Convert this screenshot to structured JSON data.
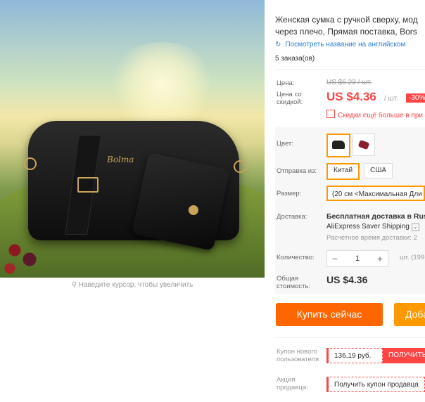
{
  "product": {
    "title_line1": "Женская сумка с ручкой сверху, мод",
    "title_line2": "через плечо, Прямая поставка, Bors",
    "translate_link": "Посмотреть название на английском",
    "orders": "5 заказа(ов)",
    "bag_logo": "Bolma"
  },
  "gallery": {
    "zoom_hint": "Наведите курсор, чтобы увеличить"
  },
  "price": {
    "label": "Цена:",
    "old": "US $6.23 / шт.",
    "discount_label": "Цена со скидкой:",
    "current": "US $4.36",
    "unit": "/ шт.",
    "discount": "-30%",
    "promo": "Скидки ещё больше в при"
  },
  "options": {
    "color_label": "Цвет:",
    "ship_from_label": "Отправка из:",
    "ship_from": [
      "Китай",
      "США"
    ],
    "ship_from_selected": 0,
    "size_label": "Размер:",
    "size_value": "(20 см <Максимальная Дли"
  },
  "delivery": {
    "label": "Доставка:",
    "main": "Бесплатная доставка в Russ",
    "service": "AliExpress Saver Shipping",
    "time": "Расчетное время доставки: 2"
  },
  "quantity": {
    "label": "Количество:",
    "minus": "−",
    "value": "1",
    "plus": "+",
    "note": "шт. (199 ш"
  },
  "total": {
    "label": "Общая стоимость:",
    "value": "US $4.36"
  },
  "buttons": {
    "buy": "Купить сейчас",
    "cart": "Доба"
  },
  "coupons": {
    "new_user_label": "Купон нового пользователя :",
    "new_user_amount": "136,19 руб.",
    "get": "ПОЛУЧИТЬ",
    "seller_label": "Акция продавца:",
    "seller_coupon": "Получить купон продавца"
  },
  "colors": {
    "accent": "#ff4444",
    "orange": "#ff6600",
    "selected_border": "#ff9900",
    "link": "#2d7ed9"
  }
}
